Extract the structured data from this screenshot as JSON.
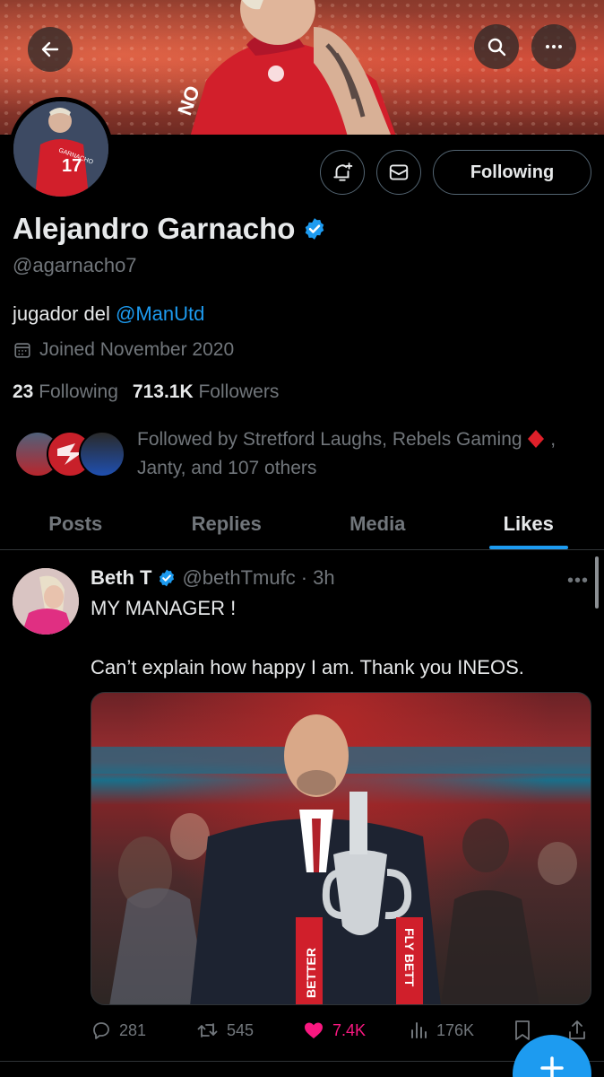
{
  "profile": {
    "name": "Alejandro Garnacho",
    "handle": "@agarnacho7",
    "bio_prefix": "jugador del ",
    "bio_link": "@ManUtd",
    "joined": "Joined November 2020",
    "following_count": "23",
    "following_label": "Following",
    "followers_count": "713.1K",
    "followers_label": "Followers",
    "followed_by_line1": "Followed by Stretford Laughs, Rebels Gaming",
    "followed_by_line2": "Janty, and 107 others",
    "follow_button": "Following",
    "avatar_number": "17",
    "avatar_shirt_text": "GARNACHO"
  },
  "header": {
    "back_icon": "arrow-left-icon",
    "search_icon": "search-icon",
    "more_icon": "more-horizontal-icon"
  },
  "tabs": [
    {
      "label": "Posts",
      "active": false
    },
    {
      "label": "Replies",
      "active": false
    },
    {
      "label": "Media",
      "active": false
    },
    {
      "label": "Likes",
      "active": true
    }
  ],
  "tweet": {
    "author": "Beth T",
    "handle": "@bethTmufc",
    "time": "· 3h",
    "text1": "MY MANAGER !",
    "text2": "Can’t explain how happy I am. Thank you INEOS.",
    "replies": "281",
    "reposts": "545",
    "likes": "7.4K",
    "views": "176K"
  },
  "colors": {
    "accent": "#1d9bf0",
    "like": "#f91880",
    "muted": "#71767b",
    "border": "#2f3336",
    "background": "#000000"
  }
}
